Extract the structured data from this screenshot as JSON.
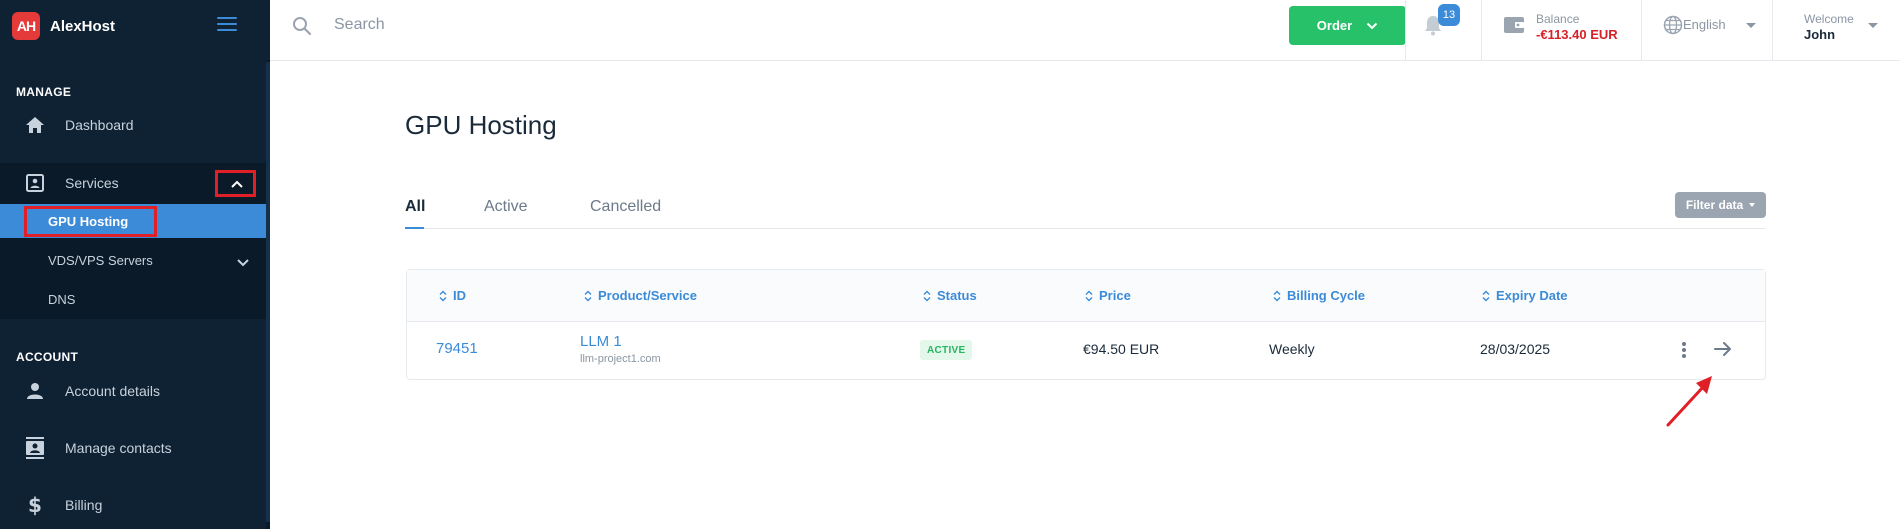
{
  "brand": {
    "logo_text": "AH",
    "name": "AlexHost"
  },
  "sidebar": {
    "sections": [
      {
        "label": "MANAGE"
      },
      {
        "label": "ACCOUNT"
      }
    ],
    "items": [
      {
        "label": "Dashboard",
        "icon": "home-icon"
      },
      {
        "label": "Services",
        "icon": "contact-card-icon"
      },
      {
        "label": "Account details",
        "icon": "person-icon"
      },
      {
        "label": "Manage contacts",
        "icon": "contacts-book-icon"
      },
      {
        "label": "Billing",
        "icon": "dollar-icon"
      }
    ],
    "services_sub": [
      {
        "label": "GPU Hosting",
        "active": true
      },
      {
        "label": "VDS/VPS Servers",
        "active": false
      },
      {
        "label": "DNS",
        "active": false
      }
    ]
  },
  "topbar": {
    "search_placeholder": "Search",
    "order_label": "Order",
    "notifications_count": "13",
    "balance_label": "Balance",
    "balance_value": "-€113.40 EUR",
    "language": "English",
    "welcome_label": "Welcome",
    "user_name": "John"
  },
  "page": {
    "title": "GPU Hosting",
    "tabs": [
      "All",
      "Active",
      "Cancelled"
    ],
    "filter_label": "Filter data"
  },
  "table": {
    "columns": [
      "ID",
      "Product/Service",
      "Status",
      "Price",
      "Billing Cycle",
      "Expiry Date"
    ],
    "rows": [
      {
        "id": "79451",
        "product": "LLM 1",
        "domain": "llm-project1.com",
        "status": "ACTIVE",
        "price": "€94.50 EUR",
        "billing_cycle": "Weekly",
        "expiry": "28/03/2025"
      }
    ]
  },
  "colors": {
    "sidebar_bg": "#0f2233",
    "accent": "#3b8bd8",
    "order_green": "#27c16a",
    "balance_red": "#d62128",
    "highlight_red": "#e01f26"
  }
}
